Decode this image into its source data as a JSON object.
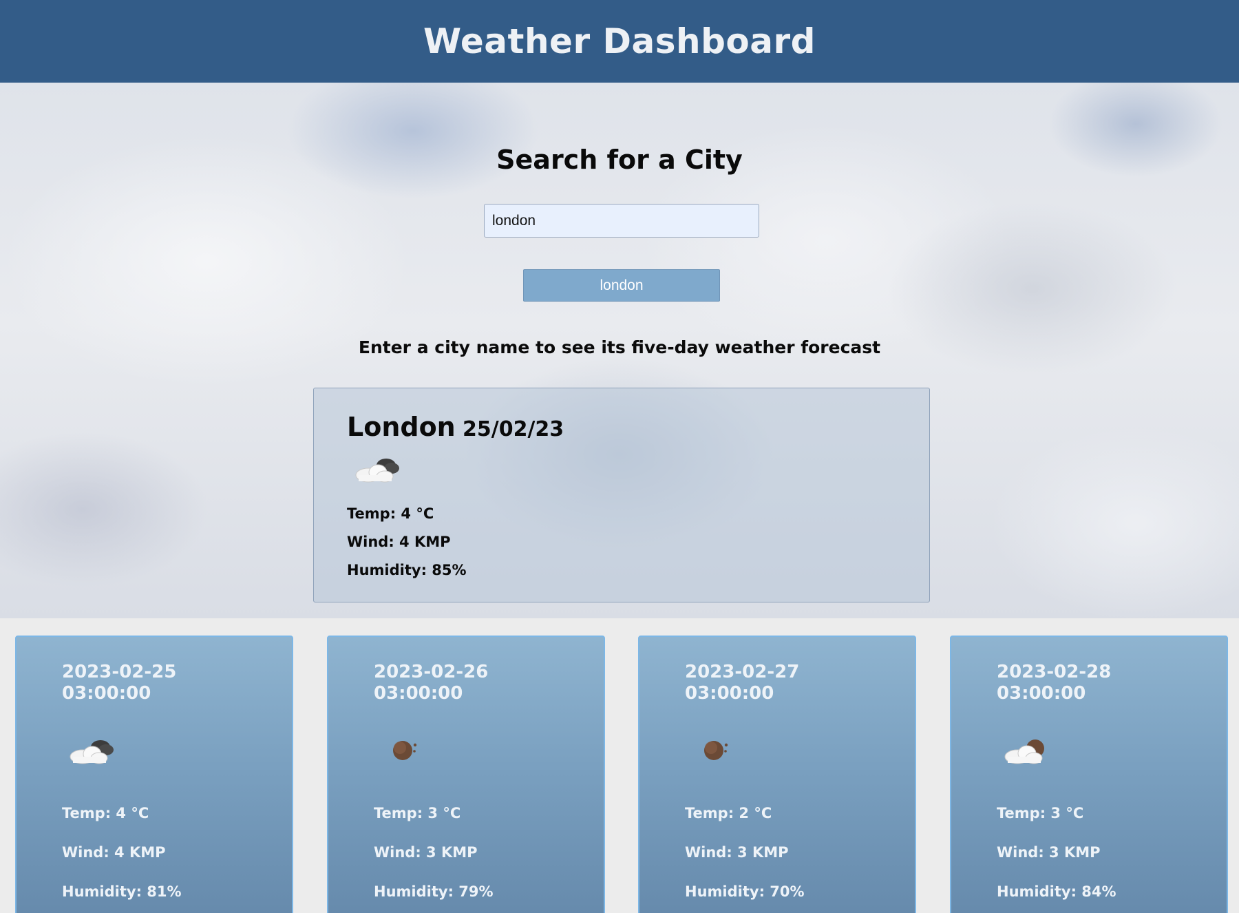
{
  "header": {
    "title": "Weather Dashboard"
  },
  "search": {
    "title": "Search for a City",
    "input_value": "london",
    "history_button_label": "london",
    "hint": "Enter a city name to see its five-day weather forecast"
  },
  "current": {
    "city": "London",
    "date": "25/02/23",
    "icon": "broken-clouds-icon",
    "temp": "Temp: 4 °C",
    "wind": "Wind: 4 KMP",
    "humidity": "Humidity: 85%"
  },
  "forecast": [
    {
      "date_line1": "2023-02-25",
      "date_line2": "03:00:00",
      "icon": "broken-clouds-icon",
      "temp": "Temp: 4 °C",
      "wind": "Wind: 4 KMP",
      "humidity": "Humidity: 81%"
    },
    {
      "date_line1": "2023-02-26",
      "date_line2": "03:00:00",
      "icon": "clear-night-icon",
      "temp": "Temp: 3 °C",
      "wind": "Wind: 3 KMP",
      "humidity": "Humidity: 79%"
    },
    {
      "date_line1": "2023-02-27",
      "date_line2": "03:00:00",
      "icon": "clear-night-icon",
      "temp": "Temp: 2 °C",
      "wind": "Wind: 3 KMP",
      "humidity": "Humidity: 70%"
    },
    {
      "date_line1": "2023-02-28",
      "date_line2": "03:00:00",
      "icon": "few-clouds-night-icon",
      "temp": "Temp: 3 °C",
      "wind": "Wind: 3 KMP",
      "humidity": "Humidity: 84%"
    }
  ],
  "colors": {
    "header_bg": "#335c88",
    "button_bg": "#7fa9cc",
    "card_border": "#7db7e6",
    "input_bg": "#e8f0fd"
  }
}
